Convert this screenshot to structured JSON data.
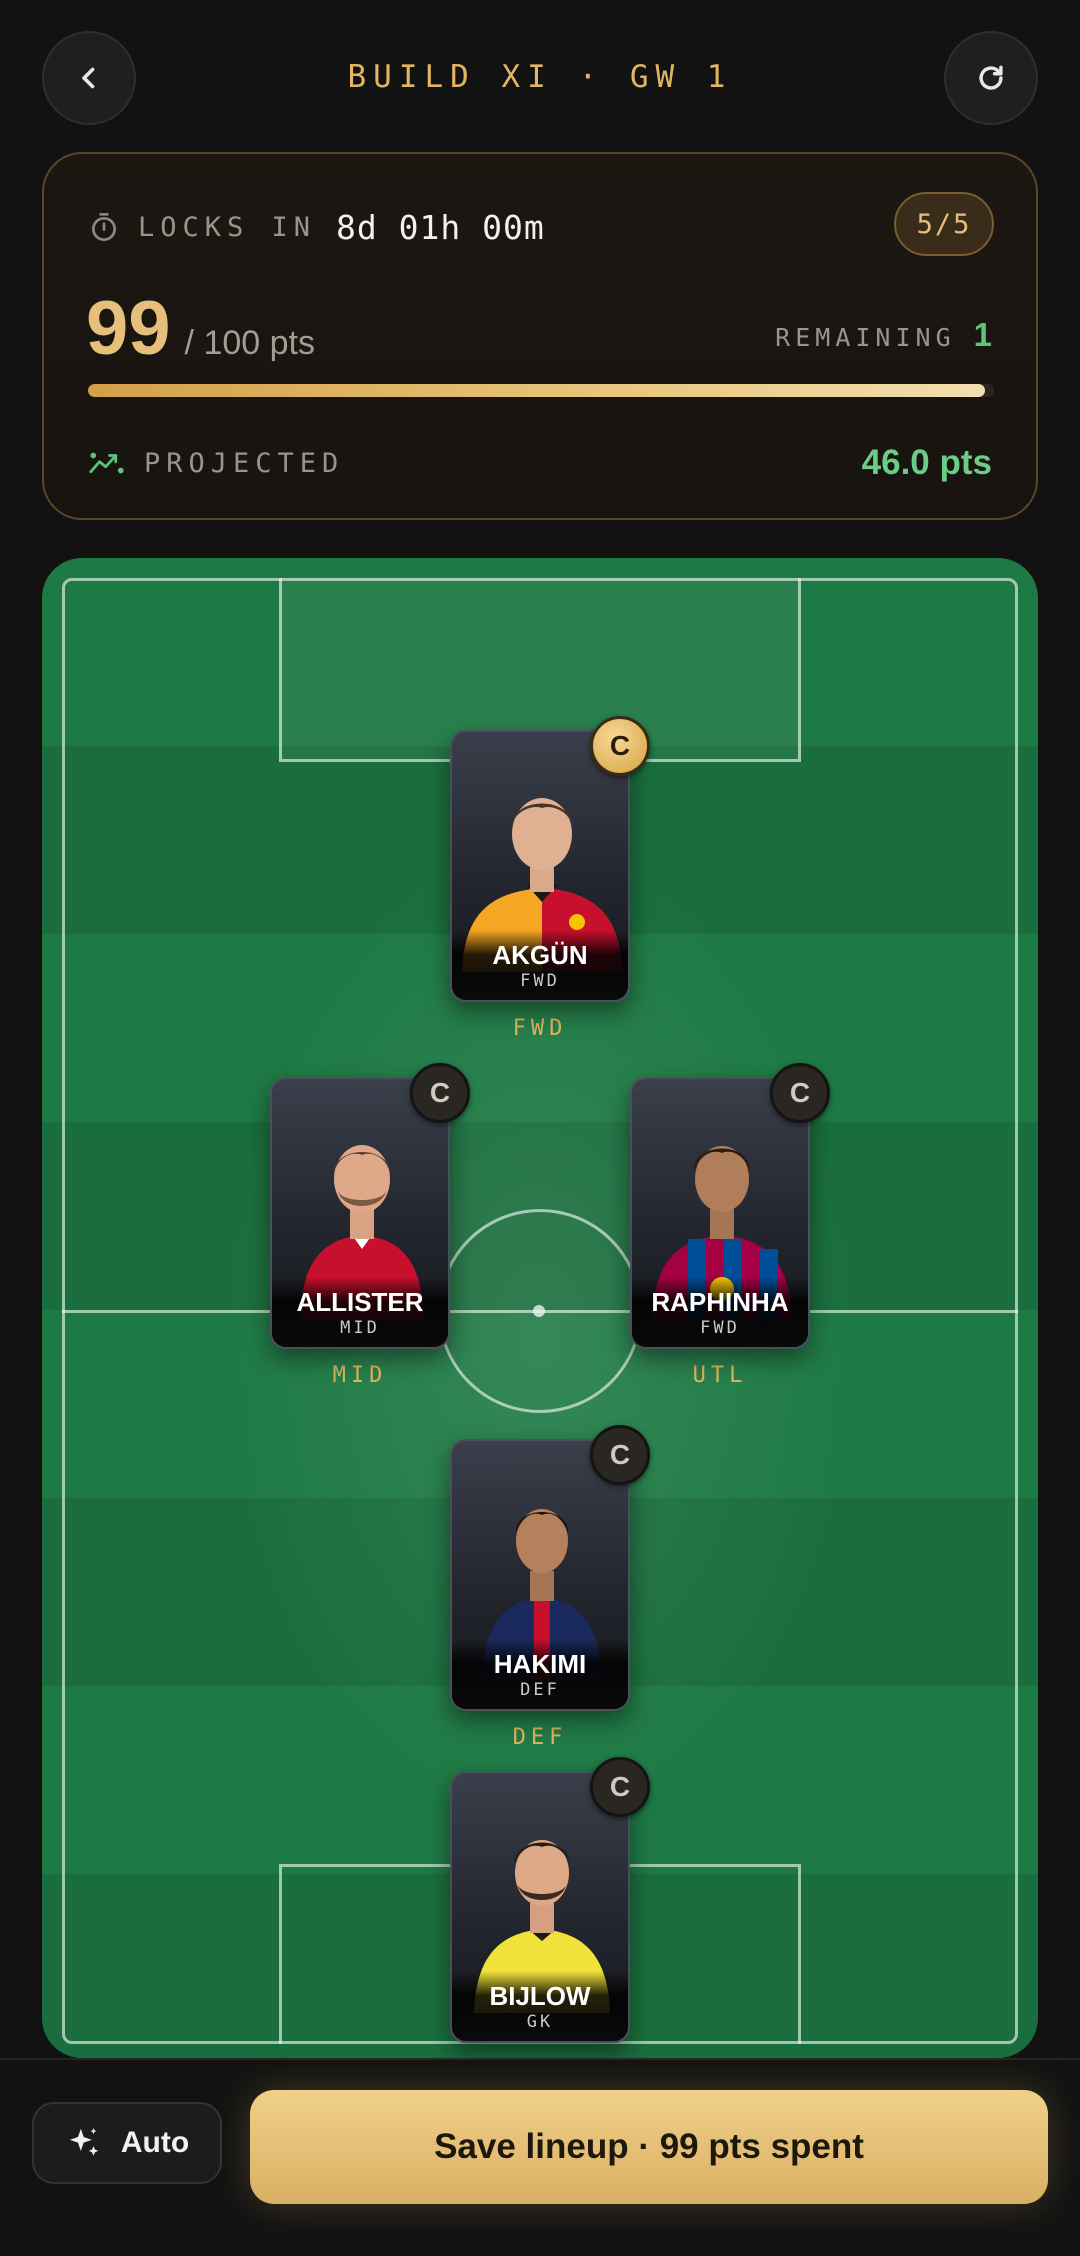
{
  "header": {
    "title": "BUILD XI · GW 1"
  },
  "budget": {
    "lock_label": "LOCKS IN",
    "lock_time": "8d 01h 00m",
    "slots": "5/5",
    "spent": "99",
    "total": "/ 100 pts",
    "remaining_label": "REMAINING",
    "remaining_value": "1",
    "progress_fraction": 0.99,
    "projected_label": "PROJECTED",
    "projected_value": "46.0 pts"
  },
  "players": [
    {
      "name": "AKGÜN",
      "position": "FWD",
      "slot": "FWD",
      "captain_mark": "C",
      "is_captain": true,
      "shirt": "galatasaray"
    },
    {
      "name": "ALLISTER",
      "position": "MID",
      "slot": "MID",
      "captain_mark": "C",
      "is_captain": false,
      "shirt": "liverpool"
    },
    {
      "name": "RAPHINHA",
      "position": "FWD",
      "slot": "UTL",
      "captain_mark": "C",
      "is_captain": false,
      "shirt": "barcelona"
    },
    {
      "name": "HAKIMI",
      "position": "DEF",
      "slot": "DEF",
      "captain_mark": "C",
      "is_captain": false,
      "shirt": "psg"
    },
    {
      "name": "BIJLOW",
      "position": "GK",
      "slot": "",
      "captain_mark": "C",
      "is_captain": false,
      "shirt": "gk-yellow"
    }
  ],
  "actions": {
    "auto_label": "Auto",
    "save_label": "Save lineup · 99 pts spent"
  },
  "colors": {
    "accent_gold": "#e2b661",
    "positive_green": "#6bcb87",
    "pitch_green": "#1e7a44",
    "background": "#121212"
  },
  "icons": {
    "back": "chevron-left-icon",
    "refresh": "refresh-icon",
    "timer": "stopwatch-icon",
    "projected": "trend-chart-icon",
    "auto": "sparkles-icon"
  }
}
